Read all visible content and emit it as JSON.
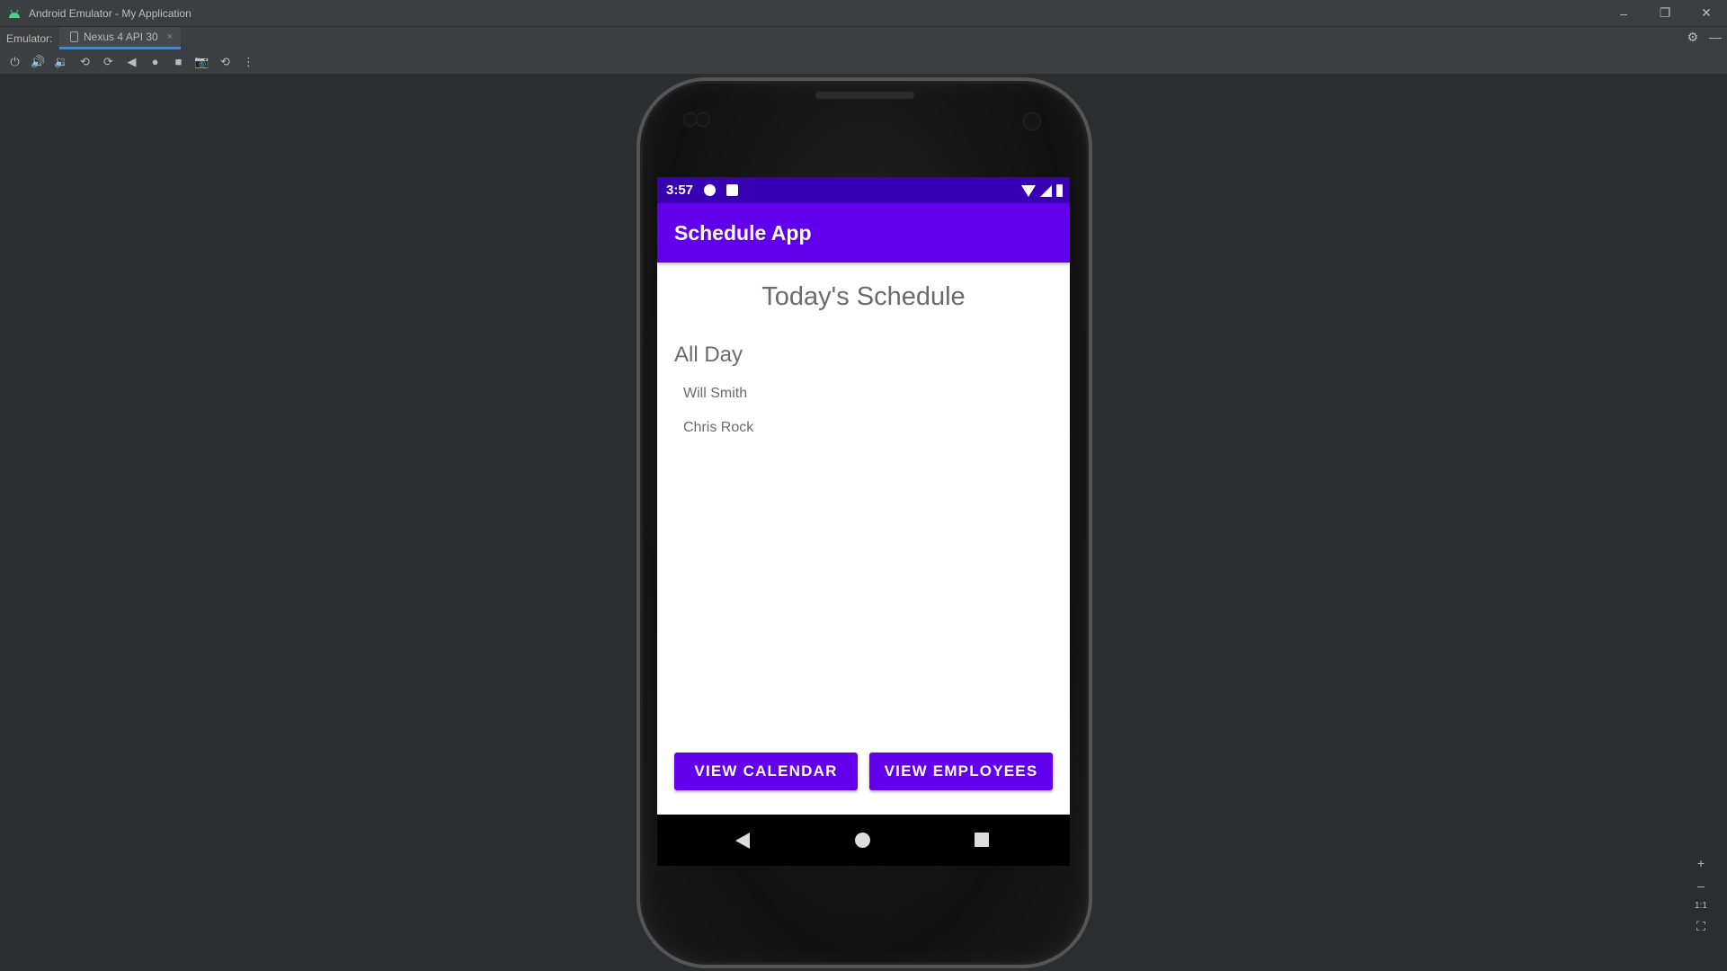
{
  "window": {
    "title": "Android Emulator - My Application",
    "minimize": "–",
    "restore": "❐",
    "close": "✕"
  },
  "tabbar": {
    "label": "Emulator:",
    "tab_label": "Nexus 4 API 30",
    "tab_close": "×",
    "settings": "⚙",
    "hide": "—"
  },
  "toolbar": {
    "icons": [
      "power-icon",
      "volume-up-icon",
      "volume-down-icon",
      "rotate-left-icon",
      "rotate-right-icon",
      "back-icon",
      "home-icon",
      "overview-icon",
      "screenshot-icon",
      "snapshot-icon",
      "more-icon"
    ],
    "glyphs": [
      "⏻",
      "🔊",
      "🔉",
      "⟲",
      "⟳",
      "◀",
      "●",
      "■",
      "📷",
      "⟲",
      "⋮"
    ]
  },
  "status_bar": {
    "time": "3:57"
  },
  "app": {
    "title": "Schedule App",
    "heading": "Today's Schedule",
    "section": "All Day",
    "people": [
      "Will Smith",
      "Chris Rock"
    ],
    "buttons": {
      "calendar": "VIEW CALENDAR",
      "employees": "VIEW EMPLOYEES"
    }
  },
  "zoom": {
    "zoom_in": "+",
    "zoom_out": "–",
    "one_to_one": "1:1",
    "fit": "⛶"
  },
  "colors": {
    "status_bar": "#3700b3",
    "app_bar": "#6200ee",
    "button": "#6200ee"
  }
}
